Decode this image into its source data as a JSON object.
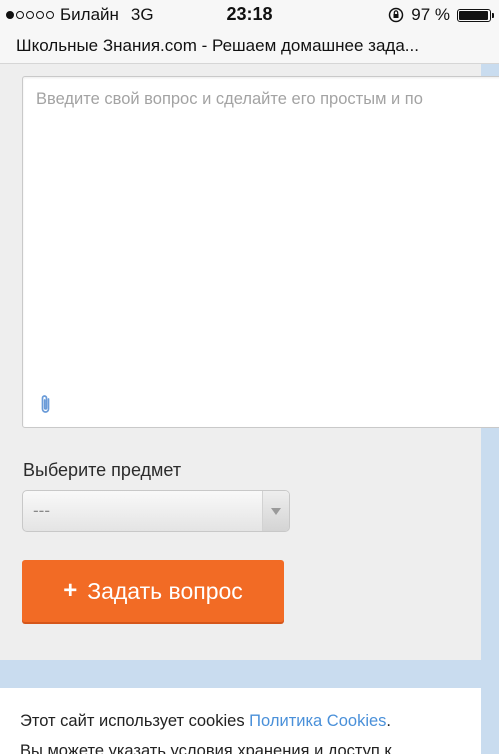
{
  "status_bar": {
    "carrier": "Билайн",
    "network": "3G",
    "time": "23:18",
    "battery": "97 %"
  },
  "browser": {
    "page_title": "Школьные Знания.com - Решаем домашнее зада..."
  },
  "form": {
    "question_placeholder": "Введите свой вопрос и сделайте его простым и по",
    "subject_label": "Выберите предмет",
    "subject_value": "---",
    "ask_button_label": "Задать вопрос"
  },
  "cookie_banner": {
    "text": "Этот сайт использует cookies",
    "link": "Политика Cookies",
    "text_end": ".",
    "text_second_line": "Вы можете указать условия хранения и доступ к"
  },
  "colors": {
    "accent": "#f26b25",
    "background": "#c9dcef",
    "link": "#4a90d9"
  }
}
